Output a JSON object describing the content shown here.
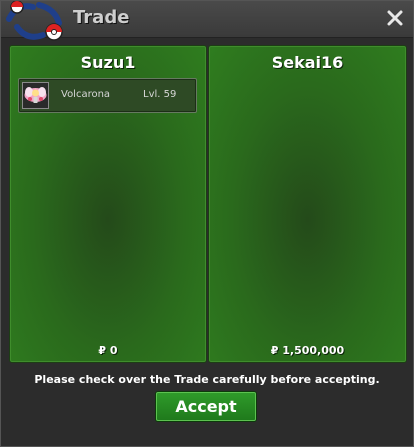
{
  "window": {
    "title": "Trade",
    "close_icon": "close-icon",
    "logo_icon": "pokeball-logo-icon"
  },
  "left_panel": {
    "player_name": "Suzu1",
    "items": [
      {
        "icon": "volcarona-sprite-icon",
        "name": "Volcarona",
        "level": "Lvl. 59"
      }
    ],
    "money": "₽ 0"
  },
  "right_panel": {
    "player_name": "Sekai16",
    "items": [],
    "money": "₽ 1,500,000"
  },
  "notice": "Please check over the Trade carefully before accepting.",
  "accept_label": "Accept",
  "colors": {
    "panel_green": "#2f7d1f",
    "button_green": "#2f9a2a",
    "title_text": "#cfcfcf"
  }
}
